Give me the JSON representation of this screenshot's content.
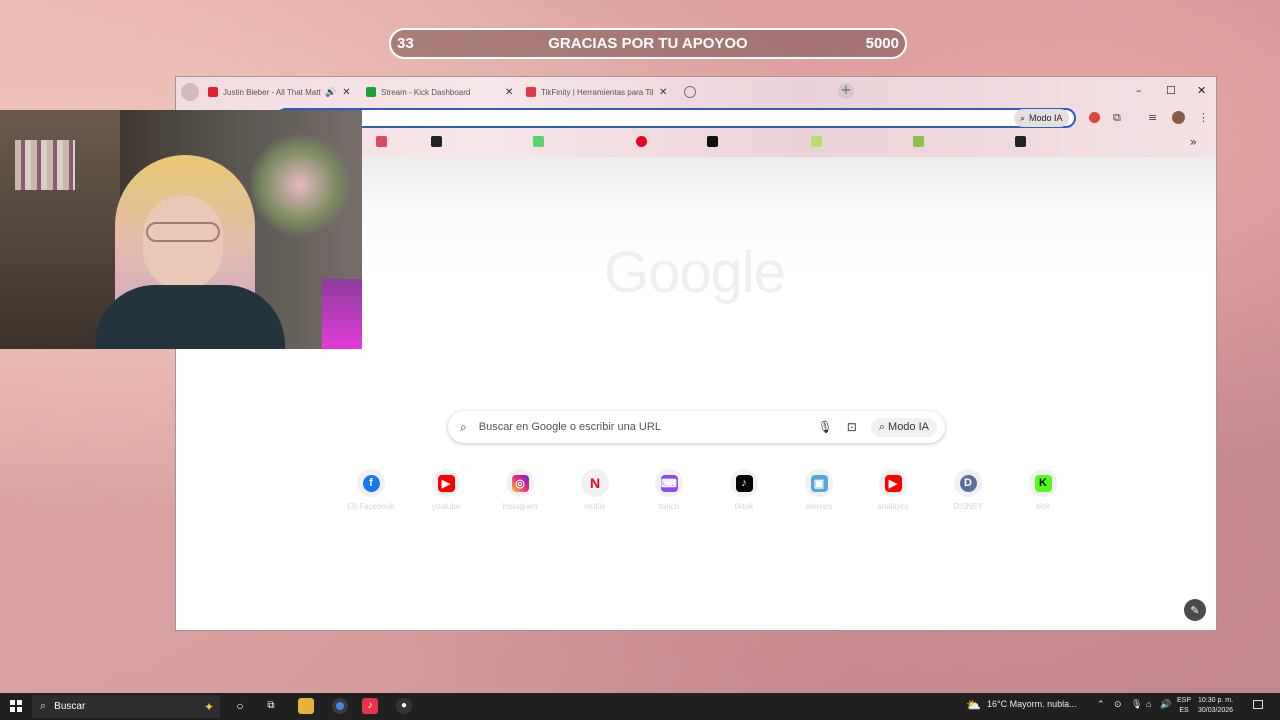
{
  "goal": {
    "current": "33",
    "title": "GRACIAS POR TU APOYOO",
    "target": "5000"
  },
  "browser": {
    "tabs": [
      {
        "label": "Justin Bieber - All That Matters",
        "favicon_color": "#e4212b",
        "audio_icon": "speaker-icon"
      },
      {
        "label": "Stream - Kick Dashboard",
        "favicon_color": "#1e9e3a"
      },
      {
        "label": "TikFinity | Herramientas para TikTok",
        "favicon_color": "#e4364a"
      }
    ],
    "toolbar": {
      "modo_ia_label": "Modo IA"
    },
    "window_controls": {
      "minimize": "–",
      "maximize": "☐",
      "close": "✕"
    }
  },
  "newtab": {
    "logo": "Google",
    "search_placeholder": "Buscar en Google o escribir una URL",
    "ai_mode_label": "Modo IA",
    "shortcuts": [
      {
        "name": "(3) Facebook",
        "glyph": "f",
        "color": "#1877f2"
      },
      {
        "name": "youtube",
        "glyph": "▶",
        "color": "#ff0000"
      },
      {
        "name": "instagram",
        "glyph": "◎",
        "color": "#d62976"
      },
      {
        "name": "netflix",
        "glyph": "N",
        "color": "#e50914"
      },
      {
        "name": "twitch",
        "glyph": "⌨",
        "color": "#9146ff"
      },
      {
        "name": "tiktok",
        "glyph": "♪",
        "color": "#000000"
      },
      {
        "name": "aternos",
        "glyph": "▣",
        "color": "#5aa7d9"
      },
      {
        "name": "analitycs",
        "glyph": "▶",
        "color": "#ff0000"
      },
      {
        "name": "DISNEY",
        "glyph": "D",
        "color": "#5a6f9a"
      },
      {
        "name": "kick",
        "glyph": "K",
        "color": "#53fc18"
      }
    ]
  },
  "taskbar": {
    "search_label": "Buscar",
    "weather": "16°C  Mayorm. nubla...",
    "lang_top": "ESP",
    "lang_bottom": "ES",
    "time": "10:30 p. m.",
    "date": "30/03/2026"
  }
}
